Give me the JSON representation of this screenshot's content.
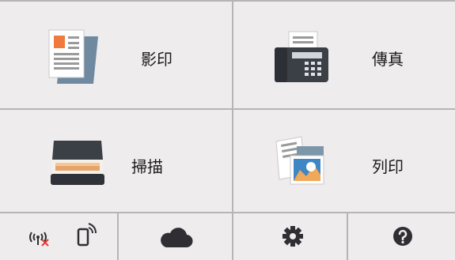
{
  "tiles": {
    "copy": {
      "label": "影印",
      "icon": "copy-icon"
    },
    "fax": {
      "label": "傳真",
      "icon": "fax-icon"
    },
    "scan": {
      "label": "掃描",
      "icon": "scanner-icon"
    },
    "print": {
      "label": "列印",
      "icon": "photo-print-icon"
    }
  },
  "bottom_bar": [
    {
      "icon": "wireless-off-icon"
    },
    {
      "icon": "mobile-connect-icon"
    },
    {
      "icon": "cloud-icon"
    },
    {
      "icon": "gear-icon"
    },
    {
      "icon": "help-icon"
    }
  ],
  "colors": {
    "background": "#efeced",
    "divider": "#b8b4b6",
    "icon_dark": "#2f2f33",
    "accent_orange": "#f07a3c",
    "error_red": "#e23a3a"
  }
}
